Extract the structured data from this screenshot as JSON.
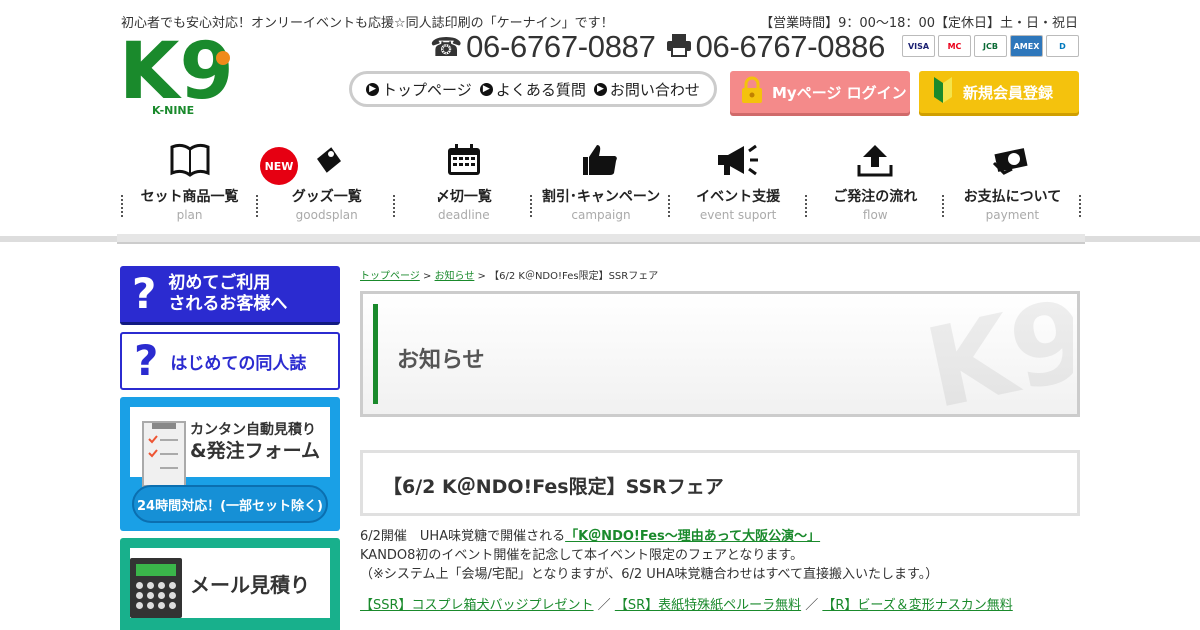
{
  "header": {
    "tagline": "初心者でも安心対応！オンリーイベントも応援☆同人誌印刷の「ケーナイン」です！",
    "hours": "【営業時間】9：00～18：00【定休日】土・日・祝日",
    "logo_text": "K9",
    "logo_sub": "K-NINE",
    "phone": "06-6767-0887",
    "fax": "06-6767-0886",
    "cards": [
      "VISA",
      "MC",
      "JCB",
      "AMEX",
      "D"
    ]
  },
  "topnav": {
    "items": [
      "トップページ",
      "よくある質問",
      "お問い合わせ"
    ]
  },
  "buttons": {
    "mypage": "Myページ ログイン",
    "register": "新規会員登録"
  },
  "gnav": {
    "new_badge": "NEW",
    "items": [
      {
        "jp": "セット商品一覧",
        "en": "plan",
        "icon": "book-icon"
      },
      {
        "jp": "グッズ一覧",
        "en": "goodsplan",
        "icon": "tag-icon"
      },
      {
        "jp": "〆切一覧",
        "en": "deadline",
        "icon": "calendar-icon"
      },
      {
        "jp": "割引･キャンペーン",
        "en": "campaign",
        "icon": "thumbs-up-icon"
      },
      {
        "jp": "イベント支援",
        "en": "event suport",
        "icon": "megaphone-icon"
      },
      {
        "jp": "ご発注の流れ",
        "en": "flow",
        "icon": "upload-icon"
      },
      {
        "jp": "お支払について",
        "en": "payment",
        "icon": "money-icon"
      }
    ]
  },
  "sidebar": {
    "first_time_line1": "初めてご利用",
    "first_time_line2": "されるお客様へ",
    "doujin": "はじめての同人誌",
    "estimate_line1": "カンタン自動見積り",
    "estimate_line2": "&発注フォーム",
    "estimate_pill": "24時間対応！(一部セット除く)",
    "mail": "メール見積り"
  },
  "breadcrumb": {
    "top": "トップページ",
    "sep": " > ",
    "news": "お知らせ",
    "current": "【6/2 K＠NDO!Fes限定】SSRフェア"
  },
  "main": {
    "section_title": "お知らせ",
    "post_title": "【6/2 K＠NDO!Fes限定】SSRフェア",
    "line1_pre": "6/2開催　UHA味覚糖で開催される",
    "line1_link": "「K＠NDO!Fes～理由あって大阪公演～」",
    "line2": "KANDO8初のイベント開催を記念して本イベント限定のフェアとなります。",
    "line3": "（※システム上「会場/宅配」となりますが、6/2 UHA味覚糖合わせはすべて直接搬入いたします。）",
    "links": [
      "【SSR】コスプレ箱犬バッジプレゼント",
      "【SR】表紙特殊紙ペルーラ無料",
      "【R】ビーズ＆変形ナスカン無料"
    ],
    "link_sep": " ／ "
  },
  "colors": {
    "brand_green": "#1a8a2c",
    "blue": "#2b2bd0",
    "pink": "#f48a8a",
    "yellow": "#f4c20d",
    "new_red": "#e60012"
  }
}
